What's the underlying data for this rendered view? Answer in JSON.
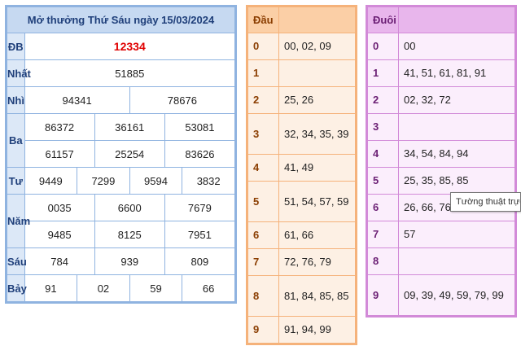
{
  "results": {
    "title": "Mở thưởng Thứ Sáu ngày 15/03/2024",
    "rows": {
      "db": {
        "label": "ĐB",
        "values": [
          "12334"
        ]
      },
      "nhat": {
        "label": "Nhất",
        "values": [
          "51885"
        ]
      },
      "nhi": {
        "label": "Nhì",
        "values": [
          "94341",
          "78676"
        ]
      },
      "ba": {
        "label": "Ba",
        "values": [
          "86372",
          "36161",
          "53081",
          "61157",
          "25254",
          "83626"
        ]
      },
      "tu": {
        "label": "Tư",
        "values": [
          "9449",
          "7299",
          "9594",
          "3832"
        ]
      },
      "nam": {
        "label": "Năm",
        "values": [
          "0035",
          "6600",
          "7679",
          "9485",
          "8125",
          "7951"
        ]
      },
      "sau": {
        "label": "Sáu",
        "values": [
          "784",
          "939",
          "809"
        ]
      },
      "bay": {
        "label": "Bảy",
        "values": [
          "91",
          "02",
          "59",
          "66"
        ]
      }
    }
  },
  "dau": {
    "header": "Đầu",
    "rows": [
      {
        "key": "0",
        "value": "00, 02, 09"
      },
      {
        "key": "1",
        "value": ""
      },
      {
        "key": "2",
        "value": "25, 26"
      },
      {
        "key": "3",
        "value": "32, 34, 35, 39"
      },
      {
        "key": "4",
        "value": "41, 49"
      },
      {
        "key": "5",
        "value": "51, 54, 57, 59"
      },
      {
        "key": "6",
        "value": "61, 66"
      },
      {
        "key": "7",
        "value": "72, 76, 79"
      },
      {
        "key": "8",
        "value": "81, 84, 85, 85"
      },
      {
        "key": "9",
        "value": "91, 94, 99"
      }
    ]
  },
  "duoi": {
    "header": "Đuôi",
    "rows": [
      {
        "key": "0",
        "value": "00"
      },
      {
        "key": "1",
        "value": "41, 51, 61, 81, 91"
      },
      {
        "key": "2",
        "value": "02, 32, 72"
      },
      {
        "key": "3",
        "value": ""
      },
      {
        "key": "4",
        "value": "34, 54, 84, 94"
      },
      {
        "key": "5",
        "value": "25, 35, 85, 85"
      },
      {
        "key": "6",
        "value": "26, 66, 76"
      },
      {
        "key": "7",
        "value": "57"
      },
      {
        "key": "8",
        "value": ""
      },
      {
        "key": "9",
        "value": "09, 39, 49, 59, 79, 99"
      }
    ]
  },
  "tooltip": {
    "text": "Tường thuật trực tiếp"
  },
  "colors": {
    "results_border": "#8fb3e0",
    "special_prize": "#e00000",
    "dau_border": "#f5b27a",
    "duoi_border": "#d28ad8"
  }
}
